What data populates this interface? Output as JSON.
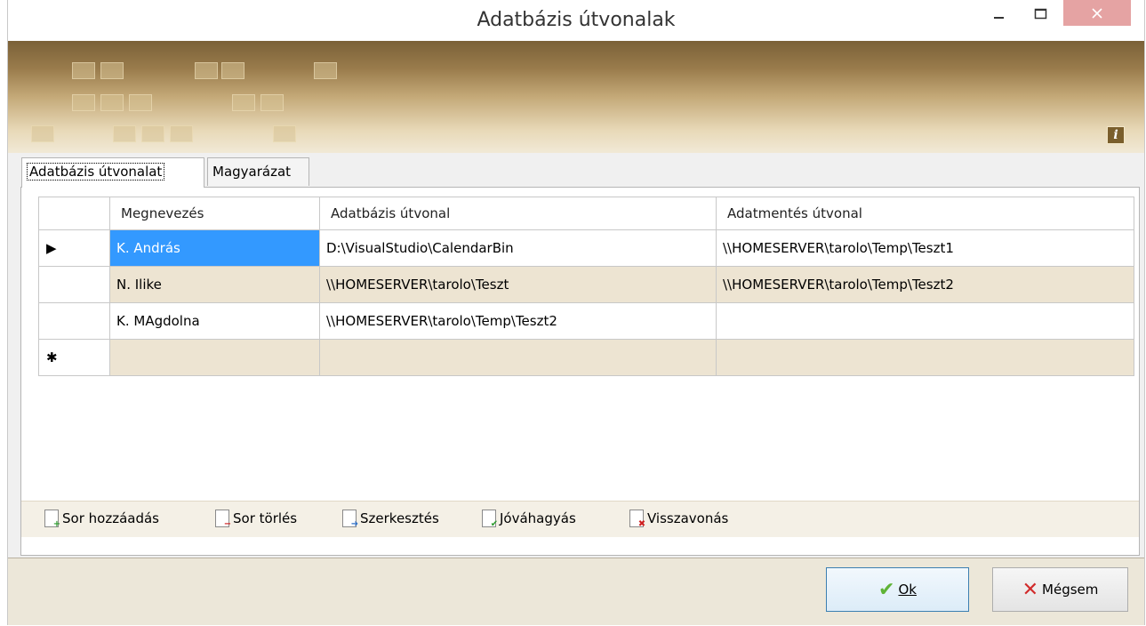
{
  "window": {
    "title": "Adatbázis útvonalak"
  },
  "tabs": [
    {
      "label": "Adatbázis útvonalat"
    },
    {
      "label": "Magyarázat"
    }
  ],
  "grid": {
    "columns": [
      "Megnevezés",
      "Adatbázis útvonal",
      "Adatmentés útvonal"
    ],
    "rows": [
      [
        "K. András",
        "D:\\VisualStudio\\CalendarBin",
        "\\\\HOMESERVER\\tarolo\\Temp\\Teszt1"
      ],
      [
        "N. Ilike",
        "\\\\HOMESERVER\\tarolo\\Teszt",
        "\\\\HOMESERVER\\tarolo\\Temp\\Teszt2"
      ],
      [
        "K. MAgdolna",
        "\\\\HOMESERVER\\tarolo\\Temp\\Teszt2",
        ""
      ]
    ],
    "current_row_marker": "▶",
    "new_row_marker": "✱"
  },
  "toolbar": {
    "add_label": "Sor hozzáadás",
    "delete_label": "Sor törlés",
    "edit_label": "Szerkesztés",
    "approve_label": "Jóváhagyás",
    "revert_label": "Visszavonás"
  },
  "footer": {
    "ok_label": "Ok",
    "cancel_label": "Mégsem"
  },
  "info_icon": "i",
  "colors": {
    "selection": "#3399ff",
    "alt_row": "#ede4d2",
    "banner_dark": "#7a6138"
  }
}
